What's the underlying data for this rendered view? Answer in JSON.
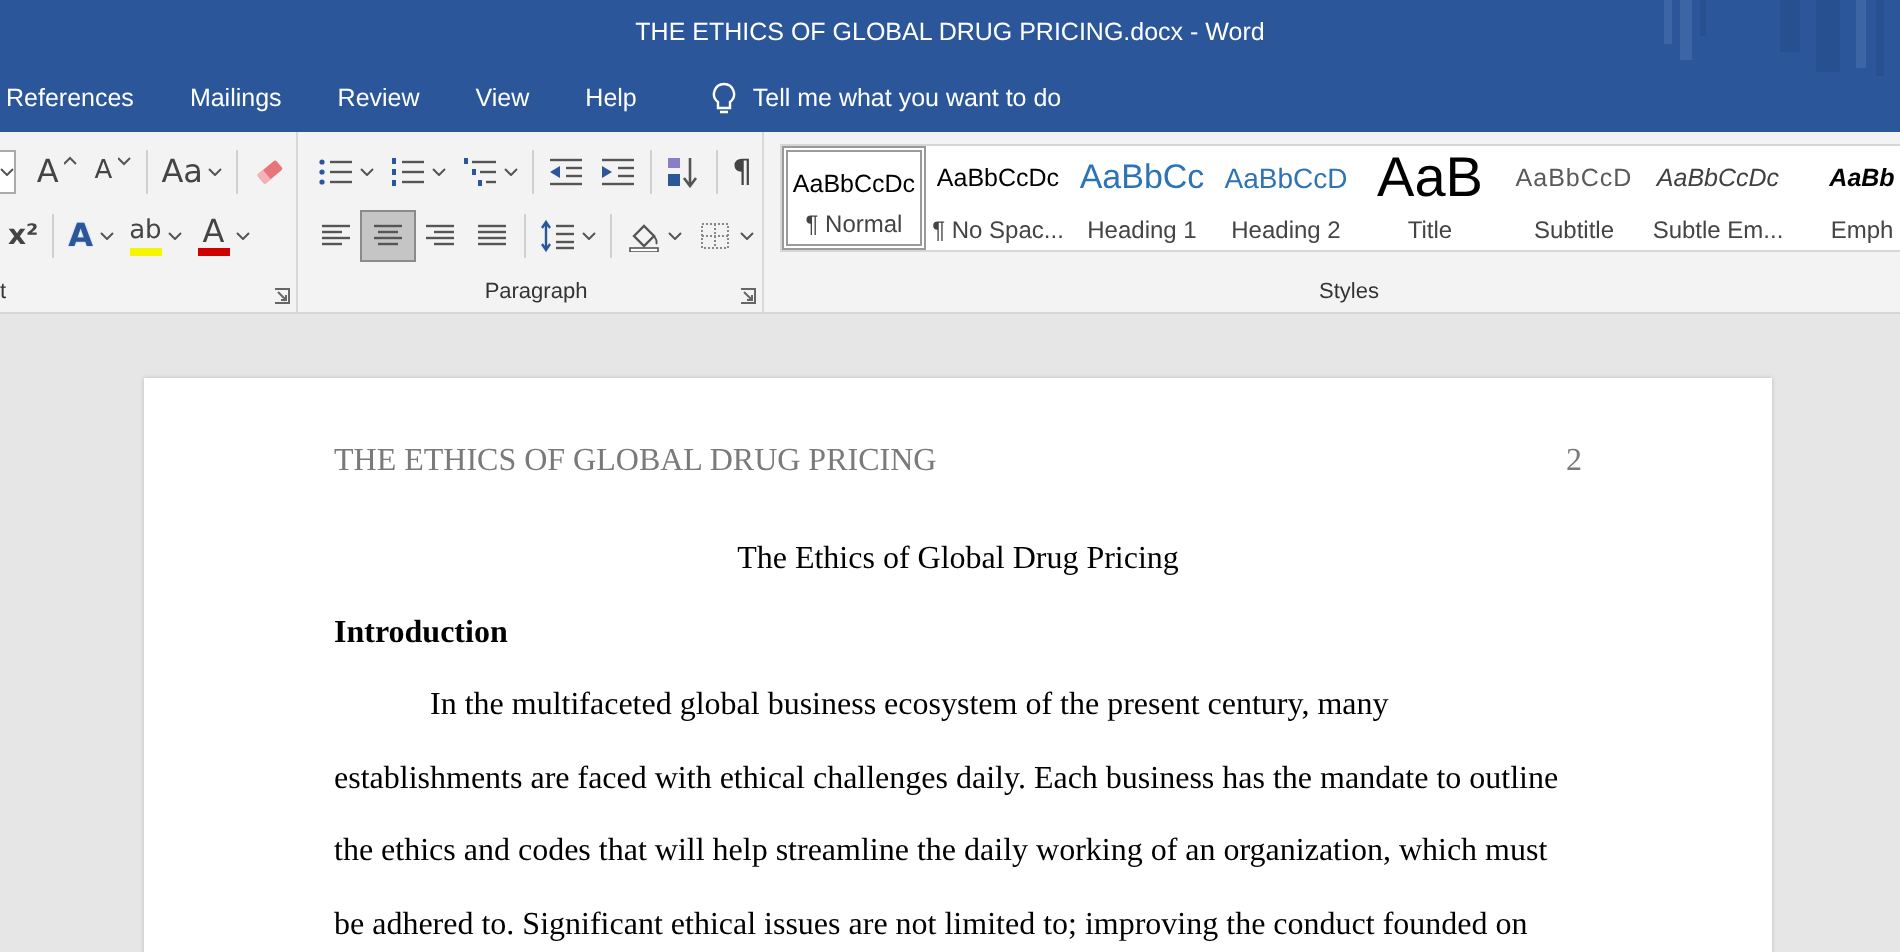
{
  "window": {
    "title": "THE ETHICS OF GLOBAL DRUG PRICING.docx  -  Word"
  },
  "tabs": [
    {
      "label": "References"
    },
    {
      "label": "Mailings"
    },
    {
      "label": "Review"
    },
    {
      "label": "View"
    },
    {
      "label": "Help"
    }
  ],
  "tell_me": {
    "placeholder": "Tell me what you want to do"
  },
  "font_group": {
    "label": "t",
    "row1": [
      {
        "kind": "grow",
        "glyph": "A"
      },
      {
        "kind": "shrink",
        "glyph": "A"
      },
      {
        "kind": "case",
        "glyph": "Aa"
      },
      {
        "kind": "clear"
      }
    ],
    "row2": [
      {
        "kind": "superscript",
        "glyph": "x²"
      },
      {
        "kind": "effects",
        "glyph": "A"
      },
      {
        "kind": "highlight",
        "glyph": "ab"
      },
      {
        "kind": "fontcolor",
        "glyph": "A"
      }
    ]
  },
  "paragraph_group": {
    "label": "Paragraph",
    "row1": [
      {
        "kind": "bullets"
      },
      {
        "kind": "numbering"
      },
      {
        "kind": "multilevel"
      },
      {
        "kind": "outdent"
      },
      {
        "kind": "indent"
      },
      {
        "kind": "sort"
      },
      {
        "kind": "marks",
        "glyph": "¶"
      }
    ],
    "alignment": [
      {
        "kind": "left",
        "selected": false
      },
      {
        "kind": "center",
        "selected": true
      },
      {
        "kind": "right",
        "selected": false
      },
      {
        "kind": "justify",
        "selected": false
      }
    ],
    "row2": [
      {
        "kind": "spacing"
      },
      {
        "kind": "shading"
      },
      {
        "kind": "borders"
      }
    ]
  },
  "styles_group": {
    "label": "Styles",
    "items": [
      {
        "kind": "normal",
        "sample": "AaBbCcDc",
        "label": "¶ Normal",
        "selected": true
      },
      {
        "kind": "normal",
        "sample": "AaBbCcDc",
        "label": "¶ No Spac...",
        "selected": false
      },
      {
        "kind": "heading1",
        "sample": "AaBbCc",
        "label": "Heading 1",
        "selected": false
      },
      {
        "kind": "heading2",
        "sample": "AaBbCcD",
        "label": "Heading 2",
        "selected": false
      },
      {
        "kind": "title",
        "sample": "AaB",
        "label": "Title",
        "selected": false
      },
      {
        "kind": "subtitle",
        "sample": "AaBbCcD",
        "label": "Subtitle",
        "selected": false
      },
      {
        "kind": "subtle",
        "sample": "AaBbCcDc",
        "label": "Subtle Em...",
        "selected": false
      },
      {
        "kind": "emphasis",
        "sample": "AaBb",
        "label": "Emph",
        "selected": false
      }
    ]
  },
  "document": {
    "header": "THE ETHICS OF GLOBAL DRUG PRICING",
    "page_number": "2",
    "title": "The Ethics of Global Drug Pricing",
    "heading": "Introduction",
    "paragraph": "In the multifaceted global business ecosystem of the present century, many establishments are faced with ethical challenges daily. Each business has the mandate to outline the ethics and codes that will help streamline the daily working of an organization, which must be adhered to. Significant ethical issues are not limited to; improving the conduct founded on"
  }
}
